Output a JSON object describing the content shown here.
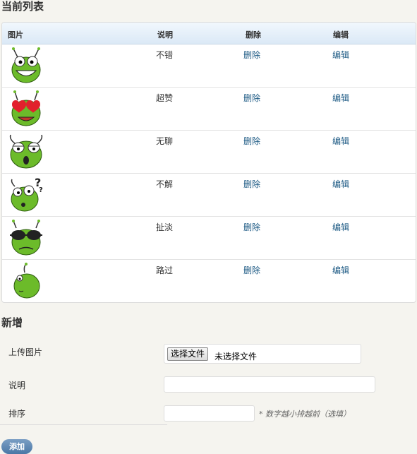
{
  "list_title": "当前列表",
  "table": {
    "headers": {
      "image": "图片",
      "desc": "说明",
      "delete": "删除",
      "edit": "编辑"
    },
    "rows": [
      {
        "icon": "smile-frog-icon",
        "desc": "不错",
        "delete": "删除",
        "edit": "编辑"
      },
      {
        "icon": "heart-eyes-frog-icon",
        "desc": "超赞",
        "delete": "删除",
        "edit": "编辑"
      },
      {
        "icon": "bored-frog-icon",
        "desc": "无聊",
        "delete": "删除",
        "edit": "编辑"
      },
      {
        "icon": "confused-frog-icon",
        "desc": "不解",
        "delete": "删除",
        "edit": "编辑"
      },
      {
        "icon": "sunglasses-frog-icon",
        "desc": "扯淡",
        "delete": "删除",
        "edit": "编辑"
      },
      {
        "icon": "passby-frog-icon",
        "desc": "路过",
        "delete": "删除",
        "edit": "编辑"
      }
    ]
  },
  "new_title": "新增",
  "form": {
    "upload_label": "上传图片",
    "file_button": "选择文件",
    "file_status": "未选择文件",
    "desc_label": "说明",
    "desc_value": "",
    "order_label": "排序",
    "order_value": "",
    "order_hint": "* 数字越小排越前（选填）",
    "submit": "添加"
  },
  "colors": {
    "link": "#1d5a84",
    "frog_green": "#6cbb2a",
    "button": "#5a84b3"
  }
}
